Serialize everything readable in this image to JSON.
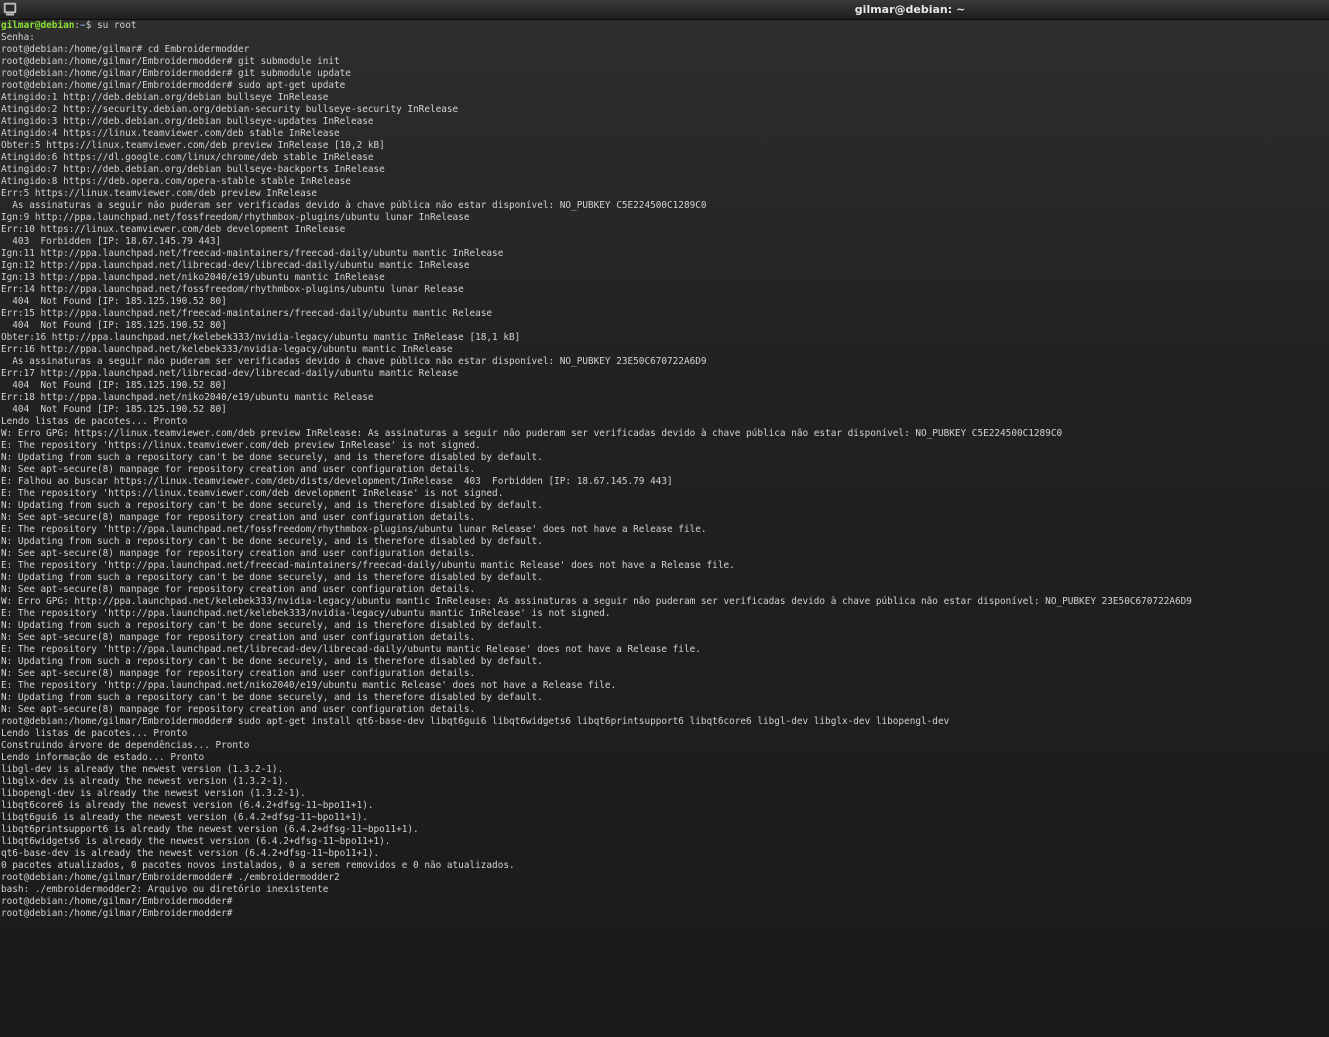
{
  "window": {
    "title": "gilmar@debian: ~",
    "icon": "terminal-icon"
  },
  "colors": {
    "background": "#1c1c1c",
    "text": "#d2d2d2",
    "prompt_user": "#8ae234",
    "prompt_path": "#729fcf"
  },
  "terminal": {
    "first_prompt": {
      "user_host": "gilmar@debian",
      "sep": ":",
      "path": "~",
      "rest": "$ su root"
    },
    "lines": [
      "Senha:",
      "root@debian:/home/gilmar# cd Embroidermodder",
      "root@debian:/home/gilmar/Embroidermodder# git submodule init",
      "root@debian:/home/gilmar/Embroidermodder# git submodule update",
      "root@debian:/home/gilmar/Embroidermodder# sudo apt-get update",
      "Atingido:1 http://deb.debian.org/debian bullseye InRelease",
      "Atingido:2 http://security.debian.org/debian-security bullseye-security InRelease",
      "Atingido:3 http://deb.debian.org/debian bullseye-updates InRelease",
      "Atingido:4 https://linux.teamviewer.com/deb stable InRelease",
      "Obter:5 https://linux.teamviewer.com/deb preview InRelease [10,2 kB]",
      "Atingido:6 https://dl.google.com/linux/chrome/deb stable InRelease",
      "Atingido:7 http://deb.debian.org/debian bullseye-backports InRelease",
      "Atingido:8 https://deb.opera.com/opera-stable stable InRelease",
      "Err:5 https://linux.teamviewer.com/deb preview InRelease",
      "  As assinaturas a seguir não puderam ser verificadas devido à chave pública não estar disponível: NO_PUBKEY C5E224500C1289C0",
      "Ign:9 http://ppa.launchpad.net/fossfreedom/rhythmbox-plugins/ubuntu lunar InRelease",
      "Err:10 https://linux.teamviewer.com/deb development InRelease",
      "  403  Forbidden [IP: 18.67.145.79 443]",
      "Ign:11 http://ppa.launchpad.net/freecad-maintainers/freecad-daily/ubuntu mantic InRelease",
      "Ign:12 http://ppa.launchpad.net/librecad-dev/librecad-daily/ubuntu mantic InRelease",
      "Ign:13 http://ppa.launchpad.net/niko2040/e19/ubuntu mantic InRelease",
      "Err:14 http://ppa.launchpad.net/fossfreedom/rhythmbox-plugins/ubuntu lunar Release",
      "  404  Not Found [IP: 185.125.190.52 80]",
      "Err:15 http://ppa.launchpad.net/freecad-maintainers/freecad-daily/ubuntu mantic Release",
      "  404  Not Found [IP: 185.125.190.52 80]",
      "Obter:16 http://ppa.launchpad.net/kelebek333/nvidia-legacy/ubuntu mantic InRelease [18,1 kB]",
      "Err:16 http://ppa.launchpad.net/kelebek333/nvidia-legacy/ubuntu mantic InRelease",
      "  As assinaturas a seguir não puderam ser verificadas devido à chave pública não estar disponível: NO_PUBKEY 23E50C670722A6D9",
      "Err:17 http://ppa.launchpad.net/librecad-dev/librecad-daily/ubuntu mantic Release",
      "  404  Not Found [IP: 185.125.190.52 80]",
      "Err:18 http://ppa.launchpad.net/niko2040/e19/ubuntu mantic Release",
      "  404  Not Found [IP: 185.125.190.52 80]",
      "Lendo listas de pacotes... Pronto",
      "W: Erro GPG: https://linux.teamviewer.com/deb preview InRelease: As assinaturas a seguir não puderam ser verificadas devido à chave pública não estar disponível: NO_PUBKEY C5E224500C1289C0",
      "E: The repository 'https://linux.teamviewer.com/deb preview InRelease' is not signed.",
      "N: Updating from such a repository can't be done securely, and is therefore disabled by default.",
      "N: See apt-secure(8) manpage for repository creation and user configuration details.",
      "E: Falhou ao buscar https://linux.teamviewer.com/deb/dists/development/InRelease  403  Forbidden [IP: 18.67.145.79 443]",
      "E: The repository 'https://linux.teamviewer.com/deb development InRelease' is not signed.",
      "N: Updating from such a repository can't be done securely, and is therefore disabled by default.",
      "N: See apt-secure(8) manpage for repository creation and user configuration details.",
      "E: The repository 'http://ppa.launchpad.net/fossfreedom/rhythmbox-plugins/ubuntu lunar Release' does not have a Release file.",
      "N: Updating from such a repository can't be done securely, and is therefore disabled by default.",
      "N: See apt-secure(8) manpage for repository creation and user configuration details.",
      "E: The repository 'http://ppa.launchpad.net/freecad-maintainers/freecad-daily/ubuntu mantic Release' does not have a Release file.",
      "N: Updating from such a repository can't be done securely, and is therefore disabled by default.",
      "N: See apt-secure(8) manpage for repository creation and user configuration details.",
      "W: Erro GPG: http://ppa.launchpad.net/kelebek333/nvidia-legacy/ubuntu mantic InRelease: As assinaturas a seguir não puderam ser verificadas devido à chave pública não estar disponível: NO_PUBKEY 23E50C670722A6D9",
      "E: The repository 'http://ppa.launchpad.net/kelebek333/nvidia-legacy/ubuntu mantic InRelease' is not signed.",
      "N: Updating from such a repository can't be done securely, and is therefore disabled by default.",
      "N: See apt-secure(8) manpage for repository creation and user configuration details.",
      "E: The repository 'http://ppa.launchpad.net/librecad-dev/librecad-daily/ubuntu mantic Release' does not have a Release file.",
      "N: Updating from such a repository can't be done securely, and is therefore disabled by default.",
      "N: See apt-secure(8) manpage for repository creation and user configuration details.",
      "E: The repository 'http://ppa.launchpad.net/niko2040/e19/ubuntu mantic Release' does not have a Release file.",
      "N: Updating from such a repository can't be done securely, and is therefore disabled by default.",
      "N: See apt-secure(8) manpage for repository creation and user configuration details.",
      "root@debian:/home/gilmar/Embroidermodder# sudo apt-get install qt6-base-dev libqt6gui6 libqt6widgets6 libqt6printsupport6 libqt6core6 libgl-dev libglx-dev libopengl-dev",
      "Lendo listas de pacotes... Pronto",
      "Construindo árvore de dependências... Pronto",
      "Lendo informação de estado... Pronto",
      "libgl-dev is already the newest version (1.3.2-1).",
      "libglx-dev is already the newest version (1.3.2-1).",
      "libopengl-dev is already the newest version (1.3.2-1).",
      "libqt6core6 is already the newest version (6.4.2+dfsg-11~bpo11+1).",
      "libqt6gui6 is already the newest version (6.4.2+dfsg-11~bpo11+1).",
      "libqt6printsupport6 is already the newest version (6.4.2+dfsg-11~bpo11+1).",
      "libqt6widgets6 is already the newest version (6.4.2+dfsg-11~bpo11+1).",
      "qt6-base-dev is already the newest version (6.4.2+dfsg-11~bpo11+1).",
      "0 pacotes atualizados, 0 pacotes novos instalados, 0 a serem removidos e 0 não atualizados.",
      "root@debian:/home/gilmar/Embroidermodder# ./embroidermodder2",
      "bash: ./embroidermodder2: Arquivo ou diretório inexistente",
      "root@debian:/home/gilmar/Embroidermodder#",
      "root@debian:/home/gilmar/Embroidermodder#"
    ]
  }
}
